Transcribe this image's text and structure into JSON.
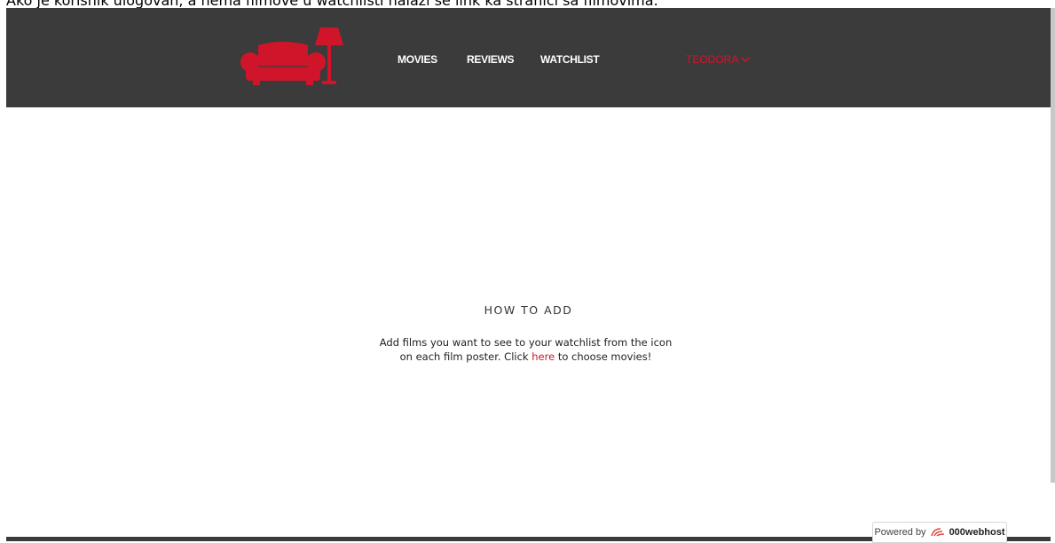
{
  "caption": "Ako je korisnik ulogovan, a nema filmove u watchlisti nalazi se link ka stranici sa filmovima.",
  "nav": {
    "movies": "MOVIES",
    "reviews": "REVIEWS",
    "watchlist": "WATCHLIST",
    "user": "TEODORA"
  },
  "main": {
    "title": "HOW TO ADD",
    "text_before": "Add films you want to see to your watchlist from the icon on each film poster. Click ",
    "link": "here",
    "text_after": " to choose movies!"
  },
  "footer": {
    "powered_by": "Powered by",
    "brand": "000webhost"
  },
  "colors": {
    "accent": "#d0152a",
    "navbar": "#3b3b3b"
  },
  "icons": {
    "logo": "sofa-lamp-logo",
    "user_dropdown": "chevron-down-icon",
    "host": "webhost-swirl-icon"
  }
}
